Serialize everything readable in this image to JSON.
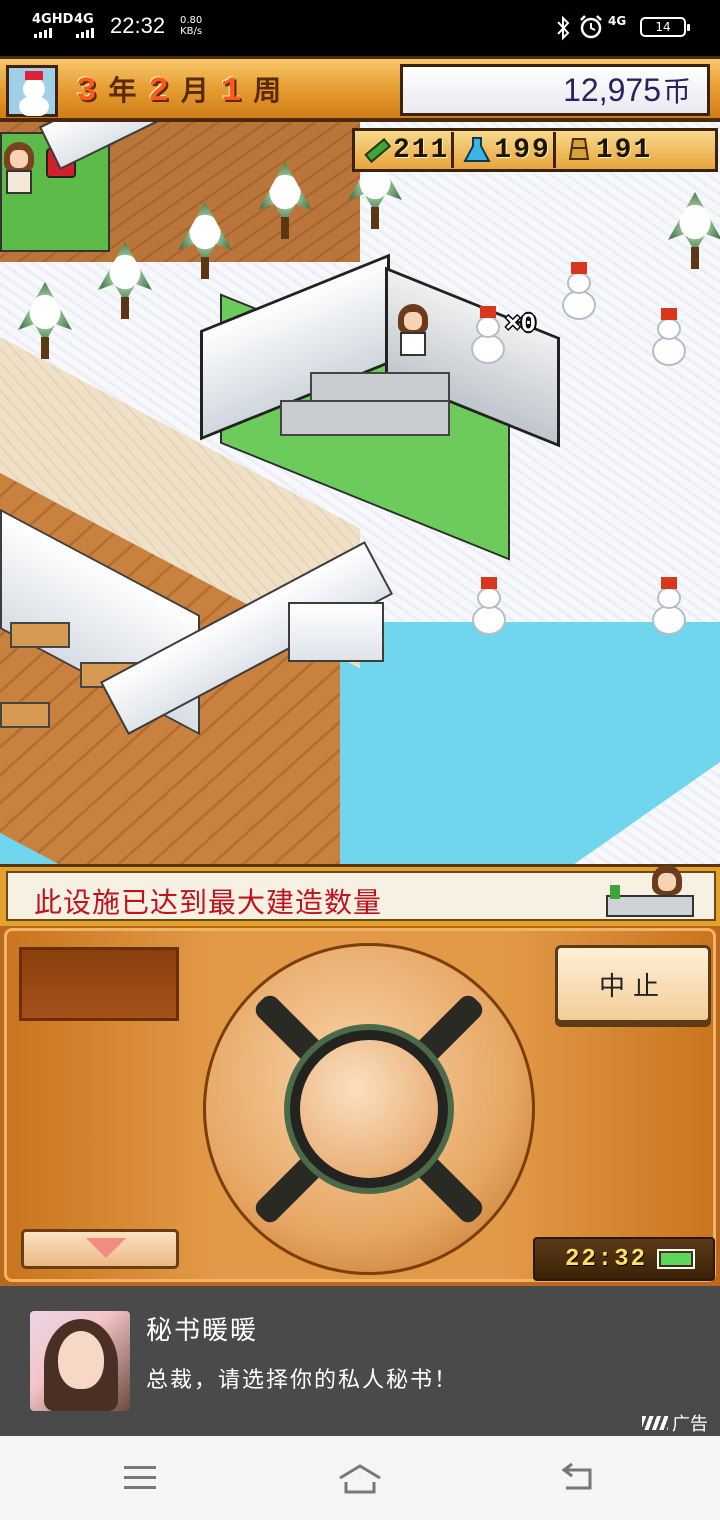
{
  "status_bar": {
    "network1": "4GHD",
    "network2": "4G",
    "time": "22:32",
    "speed_value": "0.80",
    "speed_unit": "KB/s",
    "network3": "4G",
    "battery": "14"
  },
  "top_bar": {
    "year_num": "3",
    "year_unit": "年",
    "month_num": "2",
    "month_unit": "月",
    "week_num": "1",
    "week_unit": "周",
    "money": "12,975",
    "money_unit": "币"
  },
  "resources": [
    {
      "icon": "pencil-icon",
      "value": "211"
    },
    {
      "icon": "flask-icon",
      "value": "199"
    },
    {
      "icon": "trophy-icon",
      "value": "191"
    }
  ],
  "world": {
    "snowman_counter": "×0"
  },
  "message": {
    "text": "此设施已达到最大建造数量"
  },
  "controls": {
    "stop_label": "中止",
    "clock_time": "22:32"
  },
  "ad": {
    "title": "秘书暖暖",
    "description": "总裁，请选择你的私人秘书！",
    "tag": "广告"
  },
  "colors": {
    "accent_orange": "#e59a2e",
    "message_red": "#c1121f",
    "water": "#6fd6ee",
    "money_text": "#2a2260"
  }
}
